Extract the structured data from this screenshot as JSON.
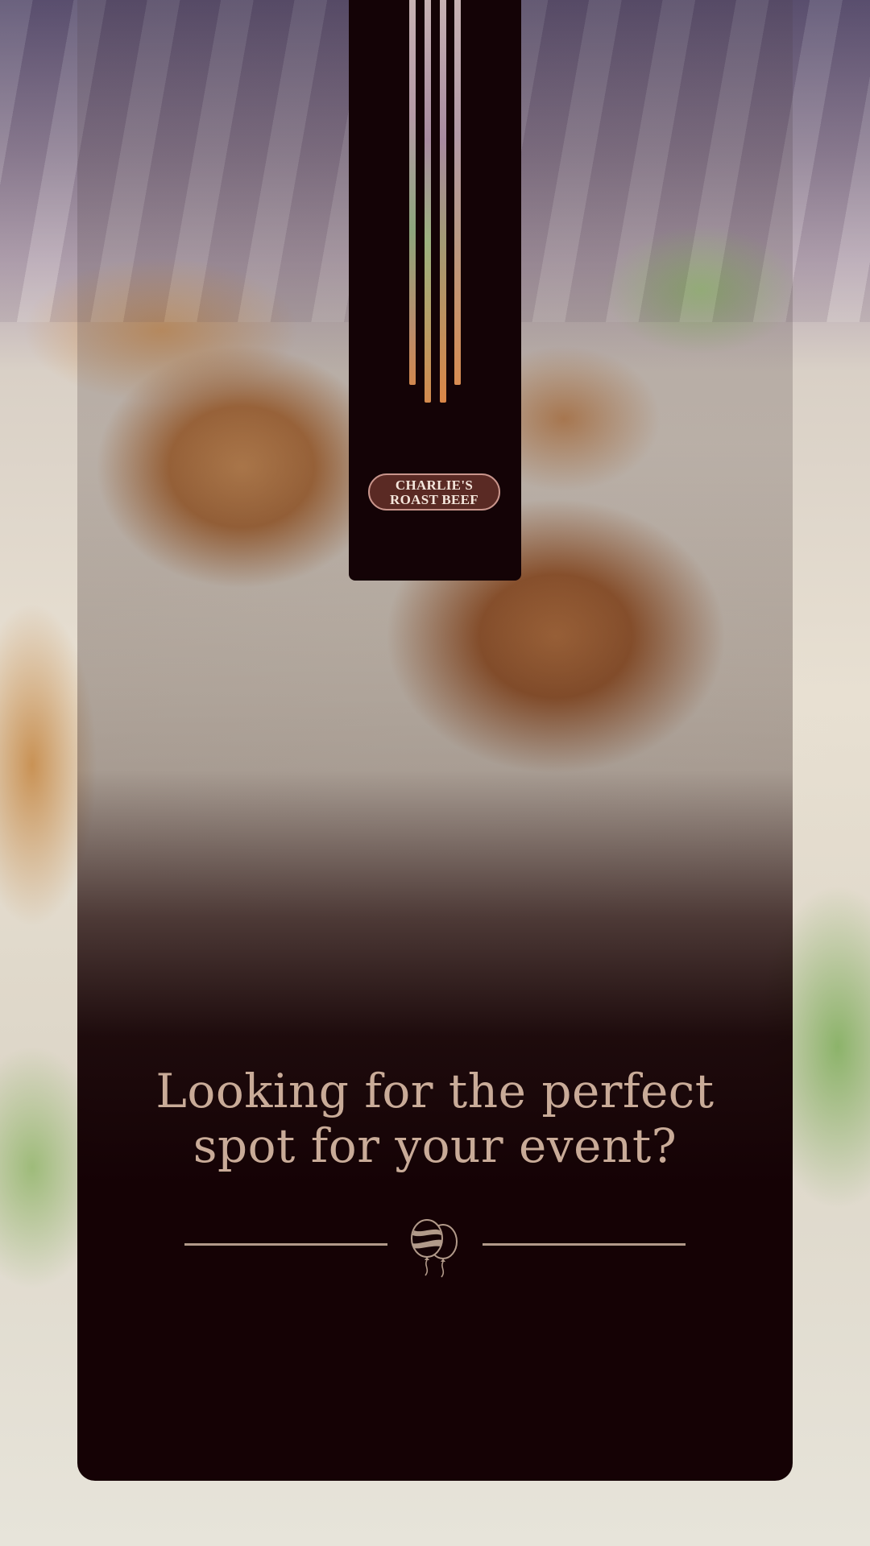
{
  "brand": {
    "logo_line1": "CHARLIE'S",
    "logo_line2": "ROAST BEEF",
    "logo_lettering_color": "#f4e6dc",
    "logo_badge_color": "#5a2a24"
  },
  "hero": {
    "headline_line1": "Looking for the perfect",
    "headline_line2": "spot for your event?",
    "headline_color": "#c9ab98"
  },
  "icons": {
    "banner": "fork-icon",
    "divider": "balloons-icon"
  },
  "colors": {
    "card_background": "#150205",
    "accent": "#b29a8a"
  }
}
